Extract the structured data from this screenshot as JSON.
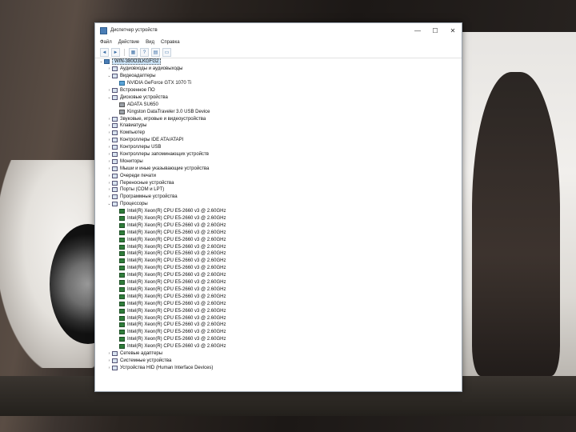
{
  "window": {
    "title": "Диспетчер устройств",
    "min_glyph": "—",
    "max_glyph": "☐",
    "close_glyph": "✕"
  },
  "menu": [
    "Файл",
    "Действие",
    "Вид",
    "Справка"
  ],
  "toolbar_icons": [
    "back-icon",
    "forward-icon",
    "properties-icon",
    "help-icon",
    "device-list-icon",
    "monitor-icon"
  ],
  "tree": {
    "root": "WIN-380O3LKGFG2",
    "categories": [
      {
        "label": "Аудиовходы и аудиовыходы",
        "expanded": false
      },
      {
        "label": "Видеоадаптеры",
        "expanded": true,
        "children": [
          "NVIDIA GeForce GTX 1070 Ti"
        ]
      },
      {
        "label": "Встроенное ПО",
        "expanded": false
      },
      {
        "label": "Дисковые устройства",
        "expanded": true,
        "children": [
          "ADATA SU650",
          "Kingston DataTraveler 3.0 USB Device"
        ]
      },
      {
        "label": "Звуковые, игровые и видеоустройства",
        "expanded": false
      },
      {
        "label": "Клавиатуры",
        "expanded": false
      },
      {
        "label": "Компьютер",
        "expanded": false
      },
      {
        "label": "Контроллеры IDE ATA/ATAPI",
        "expanded": false
      },
      {
        "label": "Контроллеры USB",
        "expanded": false
      },
      {
        "label": "Контроллеры запоминающих устройств",
        "expanded": false
      },
      {
        "label": "Мониторы",
        "expanded": false
      },
      {
        "label": "Мыши и иные указывающие устройства",
        "expanded": false
      },
      {
        "label": "Очереди печати",
        "expanded": false
      },
      {
        "label": "Переносные устройства",
        "expanded": false
      },
      {
        "label": "Порты (COM и LPT)",
        "expanded": false
      },
      {
        "label": "Программные устройства",
        "expanded": false
      },
      {
        "label": "Процессоры",
        "expanded": true,
        "children": [
          "Intel(R) Xeon(R) CPU E5-2660 v3 @ 2.60GHz",
          "Intel(R) Xeon(R) CPU E5-2660 v3 @ 2.60GHz",
          "Intel(R) Xeon(R) CPU E5-2660 v3 @ 2.60GHz",
          "Intel(R) Xeon(R) CPU E5-2660 v3 @ 2.60GHz",
          "Intel(R) Xeon(R) CPU E5-2660 v3 @ 2.60GHz",
          "Intel(R) Xeon(R) CPU E5-2660 v3 @ 2.60GHz",
          "Intel(R) Xeon(R) CPU E5-2660 v3 @ 2.60GHz",
          "Intel(R) Xeon(R) CPU E5-2660 v3 @ 2.60GHz",
          "Intel(R) Xeon(R) CPU E5-2660 v3 @ 2.60GHz",
          "Intel(R) Xeon(R) CPU E5-2660 v3 @ 2.60GHz",
          "Intel(R) Xeon(R) CPU E5-2660 v3 @ 2.60GHz",
          "Intel(R) Xeon(R) CPU E5-2660 v3 @ 2.60GHz",
          "Intel(R) Xeon(R) CPU E5-2660 v3 @ 2.60GHz",
          "Intel(R) Xeon(R) CPU E5-2660 v3 @ 2.60GHz",
          "Intel(R) Xeon(R) CPU E5-2660 v3 @ 2.60GHz",
          "Intel(R) Xeon(R) CPU E5-2660 v3 @ 2.60GHz",
          "Intel(R) Xeon(R) CPU E5-2660 v3 @ 2.60GHz",
          "Intel(R) Xeon(R) CPU E5-2660 v3 @ 2.60GHz",
          "Intel(R) Xeon(R) CPU E5-2660 v3 @ 2.60GHz",
          "Intel(R) Xeon(R) CPU E5-2660 v3 @ 2.60GHz"
        ]
      },
      {
        "label": "Сетевые адаптеры",
        "expanded": false
      },
      {
        "label": "Системные устройства",
        "expanded": false
      },
      {
        "label": "Устройства HID (Human Interface Devices)",
        "expanded": false
      }
    ]
  },
  "colors": {
    "selection": "#cce4f7",
    "cpu_icon": "#2f7d3a",
    "window_border": "#9aa3ad"
  }
}
